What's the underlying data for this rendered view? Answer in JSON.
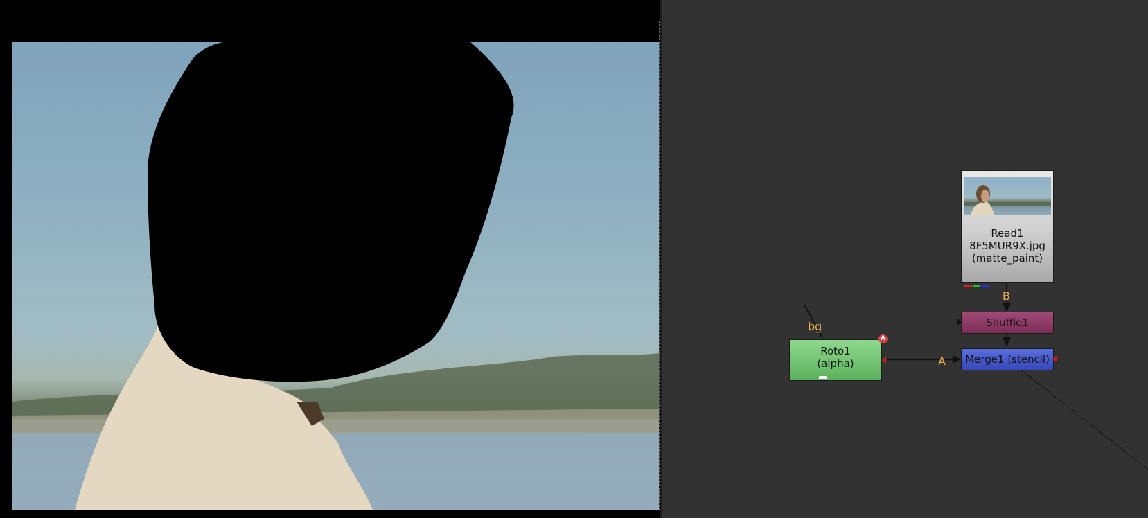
{
  "viewer": {
    "image_description_colors": {
      "sky": "#8fb0c1",
      "matte": "#000000",
      "shirt": "#e6dcc4"
    }
  },
  "node_graph": {
    "background": "#323232",
    "nodes": {
      "read": {
        "name": "Read1",
        "file": "8F5MUR9X.jpg",
        "layer": "(matte_paint)",
        "channel_colors": [
          "#e02020",
          "#20c020",
          "#2030e0"
        ]
      },
      "shuffle": {
        "name": "Shuffle1",
        "color": "#8e3a66"
      },
      "merge": {
        "name": "Merge1 (stencil)",
        "color": "#4a5dd0"
      },
      "roto": {
        "name": "Roto1",
        "output": "(alpha)",
        "color": "#74c874",
        "badge": "A"
      }
    },
    "pipe_labels": {
      "b": "B",
      "a": "A",
      "bg": "bg"
    }
  }
}
